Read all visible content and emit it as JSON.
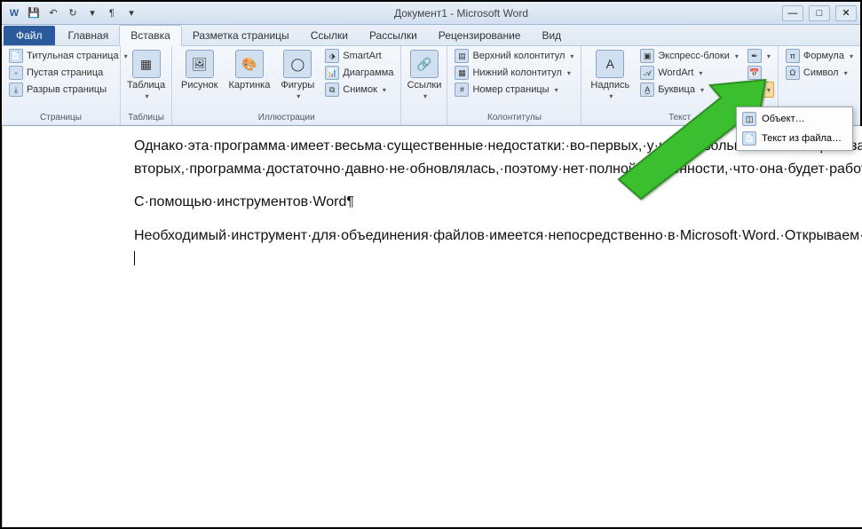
{
  "window": {
    "title": "Документ1 - Microsoft Word"
  },
  "tabs": {
    "file": "Файл",
    "items": [
      "Главная",
      "Вставка",
      "Разметка страницы",
      "Ссылки",
      "Рассылки",
      "Рецензирование",
      "Вид"
    ],
    "active_index": 1
  },
  "ribbon": {
    "groups": {
      "pages": {
        "title": "Страницы",
        "cover_page": "Титульная страница",
        "blank_page": "Пустая страница",
        "page_break": "Разрыв страницы"
      },
      "tables": {
        "title": "Таблицы",
        "table": "Таблица"
      },
      "illustrations": {
        "title": "Иллюстрации",
        "picture": "Рисунок",
        "clipart": "Картинка",
        "shapes": "Фигуры",
        "smartart": "SmartArt",
        "chart": "Диаграмма",
        "screenshot": "Снимок"
      },
      "links": {
        "title": "",
        "hyperlink": "Ссылки"
      },
      "header_footer": {
        "title": "Колонтитулы",
        "header": "Верхний колонтитул",
        "footer": "Нижний колонтитул",
        "page_number": "Номер страницы"
      },
      "text": {
        "title": "Текст",
        "textbox": "Надпись",
        "quick_parts": "Экспресс-блоки",
        "wordart": "WordArt",
        "drop_cap": "Буквица"
      },
      "symbols": {
        "title": "",
        "equation": "Формула",
        "symbol": "Символ"
      }
    }
  },
  "object_menu": {
    "object": "Объект…",
    "text_from_file": "Текст из файла…"
  },
  "document": {
    "para1": "Однако·эта·программа·имеет·весьма·существенные·недостатки:·во-первых,·у·нее·довольно·высокая·цена·за·полнофункциональную·версию·-·$29.95,·а·во-вторых,·программа·достаточно·давно·не·обновлялась,·поэтому·нет·полной·уверенности,·что·она·будет·работать·с·документами,·созданными·в·последних·версиях·Word.¶",
    "para2": "С·помощью·инструментов·Word¶",
    "para3": "Необходимый·инструмент·для·объединения·файлов·имеется·непосредственно·в·Microsoft·Word.·Открываем·в·редакторе·исходный·текстовый·документ·и·устанавливаем·курсор·в·том·месте,·где·мы·хотим·выполнить·вставку·другого·документа.·¶"
  }
}
